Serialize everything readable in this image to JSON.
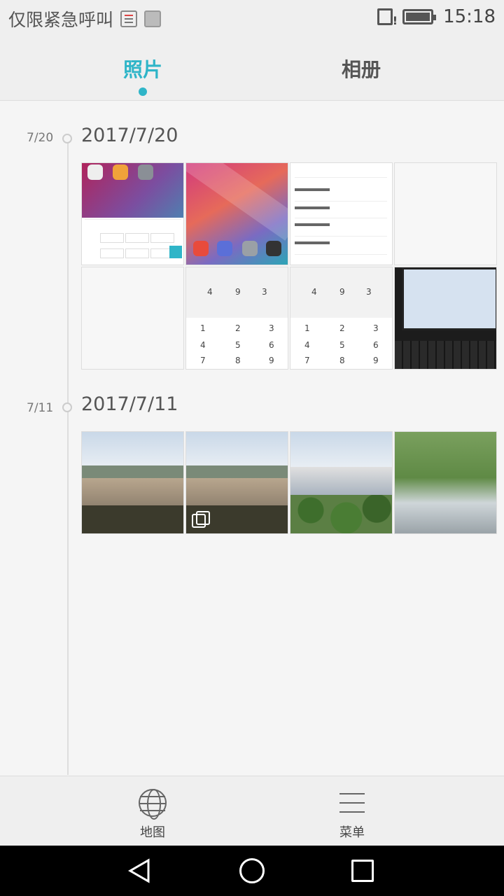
{
  "status_bar": {
    "carrier_text": "仅限紧急呼叫",
    "time": "15:18",
    "icons": [
      "note-icon",
      "image-icon",
      "sim-alert-icon",
      "battery-icon"
    ],
    "battery_level": 1.0
  },
  "tabs": [
    {
      "label": "照片",
      "active": true
    },
    {
      "label": "相册",
      "active": false
    }
  ],
  "accent_color": "#2fb5c8",
  "sections": [
    {
      "short_date": "7/20",
      "date": "2017/7/20",
      "photos": [
        {
          "kind": "keyboard-screenshot"
        },
        {
          "kind": "homescreen-screenshot"
        },
        {
          "kind": "settings-screenshot"
        },
        {
          "kind": "blank-screenshot"
        },
        {
          "kind": "blank-screenshot"
        },
        {
          "kind": "dialer-screenshot"
        },
        {
          "kind": "dialer-screenshot"
        },
        {
          "kind": "computer-photo"
        }
      ]
    },
    {
      "short_date": "7/11",
      "date": "2017/7/11",
      "photos": [
        {
          "kind": "building-photo"
        },
        {
          "kind": "building-photo-burst"
        },
        {
          "kind": "rooftop-photo"
        },
        {
          "kind": "greenhouse-photo"
        }
      ]
    }
  ],
  "bottom_actions": [
    {
      "label": "地图",
      "icon": "globe-icon"
    },
    {
      "label": "菜单",
      "icon": "menu-icon"
    }
  ],
  "nav_bar": {
    "icons": [
      "back-icon",
      "home-icon",
      "recents-icon"
    ]
  }
}
